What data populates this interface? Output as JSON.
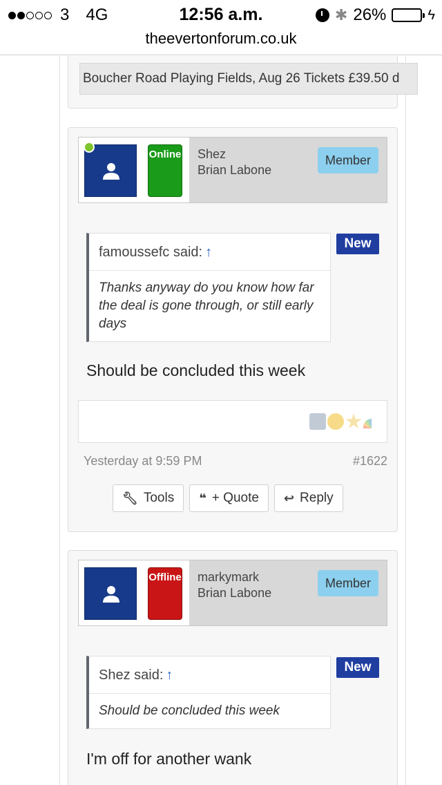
{
  "status_bar": {
    "carrier": "3",
    "network": "4G",
    "time": "12:56 a.m.",
    "battery_percent": "26%",
    "battery_level": 0.26
  },
  "url_bar": {
    "domain": "theevertonforum.co.uk"
  },
  "previous_post": {
    "banner_text": "Boucher Road Playing Fields, Aug 26 Tickets £39.50 d"
  },
  "posts": [
    {
      "username": "Shez",
      "user_title": "Brian Labone",
      "status_label": "Online",
      "role_badge": "Member",
      "new_badge": "New",
      "quote_author": "famoussefc said:",
      "quote_arrow": "↑",
      "quote_text": "Thanks anyway do you know how far the deal is gone through, or still early days",
      "message": "Should be concluded this week",
      "date": "Yesterday at 9:59 PM",
      "post_number": "#1622",
      "actions": {
        "tools": "Tools",
        "quote": "+ Quote",
        "reply": "Reply"
      }
    },
    {
      "username": "markymark",
      "user_title": "Brian Labone",
      "status_label": "Offline",
      "role_badge": "Member",
      "new_badge": "New",
      "quote_author": "Shez said:",
      "quote_arrow": "↑",
      "quote_text": "Should be concluded this week",
      "message": "I'm off for another wank"
    }
  ],
  "colors": {
    "avatar_bg": "#173a8a",
    "online": "#1a9b1a",
    "offline": "#c91515",
    "member_badge": "#8ccfee",
    "new_badge": "#1f3ea0"
  }
}
